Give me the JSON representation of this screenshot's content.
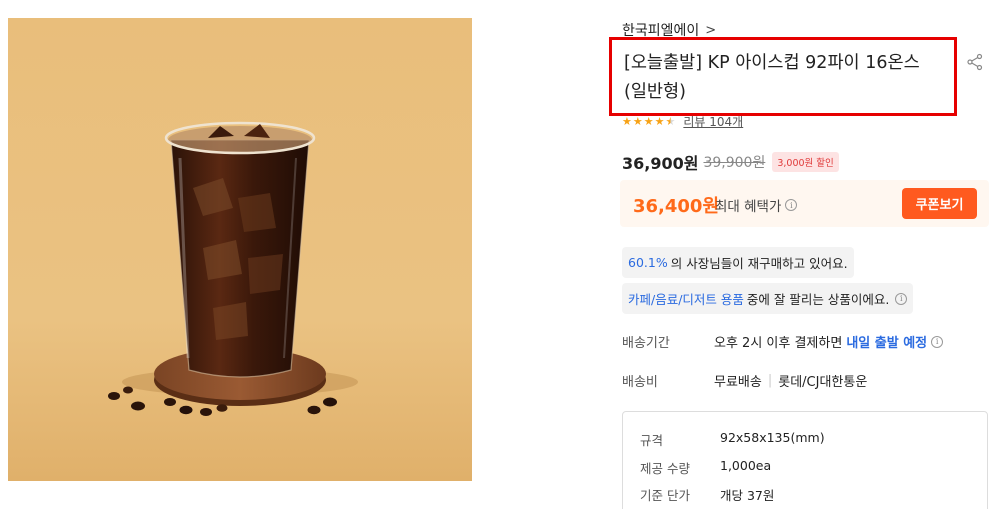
{
  "brand": {
    "name": "한국피엘에이",
    "chevron": ">"
  },
  "product": {
    "title_line1": "[오늘출발] KP 아이스컵 92파이 16온스",
    "title_line2": "(일반형)"
  },
  "rating": {
    "stars": 4.5,
    "review_label": "리뷰 104개"
  },
  "price": {
    "current": "36,900원",
    "original": "39,900원",
    "discount_badge": "3,000원 할인"
  },
  "best_price": {
    "amount": "36,400원",
    "label": "최대 혜택가",
    "coupon_button": "쿠폰보기",
    "info_glyph": "i"
  },
  "tags": {
    "reorder_highlight": "60.1%",
    "reorder_text": "의 사장님들이 재구매하고 있어요.",
    "category_highlight": "카페/음료/디저트 용품",
    "category_text": " 중에 잘 팔리는 상품이에요."
  },
  "shipping": {
    "period_label": "배송기간",
    "period_text": "오후 2시 이후 결제하면",
    "period_highlight": "내일 출발 예정",
    "fee_label": "배송비",
    "fee_free": "무료배송",
    "fee_carrier": "롯데/CJ대한통운"
  },
  "specs": [
    {
      "label": "규격",
      "value": "92x58x135(mm)"
    },
    {
      "label": "제공 수량",
      "value": "1,000ea"
    },
    {
      "label": "기준 단가",
      "value": "개당 37원"
    }
  ],
  "colors": {
    "accent_orange": "#ff5a1f",
    "price_orange": "#ff6a1a",
    "highlight_blue": "#2b6be0",
    "title_box_border": "#e60000",
    "star": "#f7a215"
  }
}
